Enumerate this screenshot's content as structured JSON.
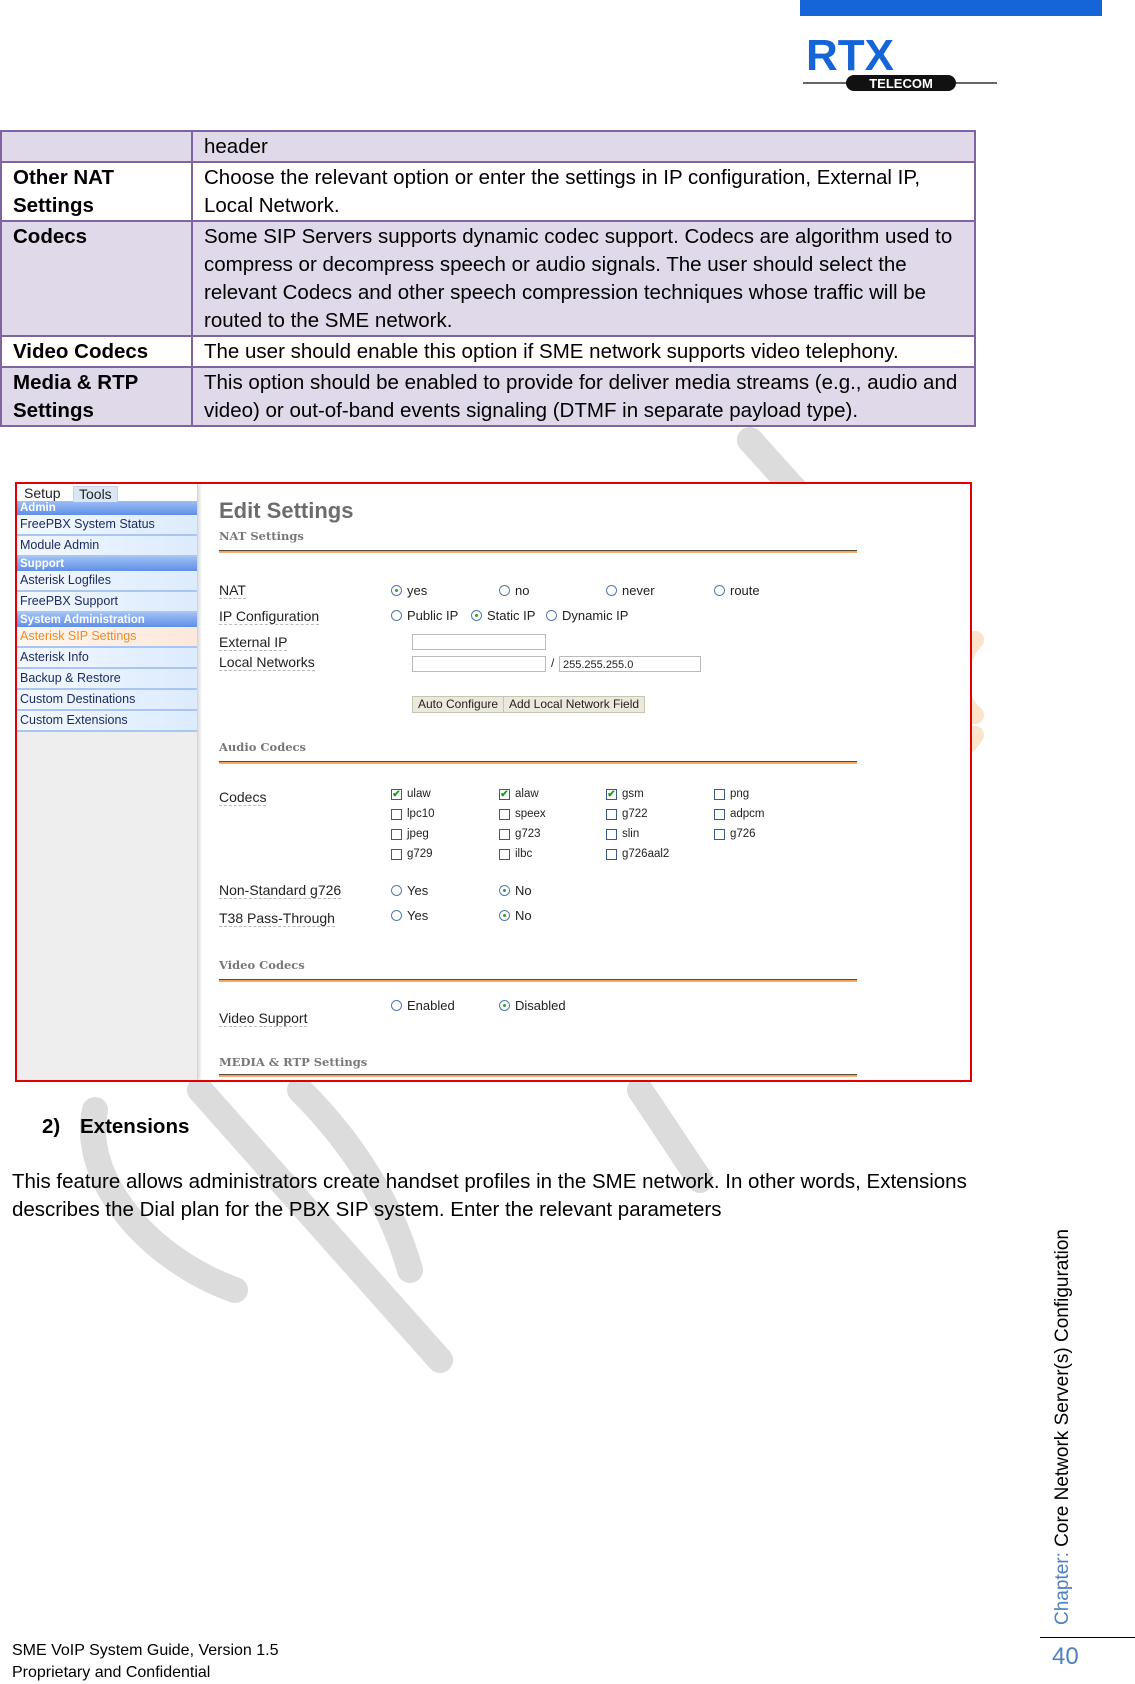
{
  "header": {
    "logo_main": "RTX",
    "logo_sub": "TELECOM",
    "colors": {
      "brand_blue": "#1565d8",
      "table_border": "#8064a2",
      "table_shade": "#e0d9ea",
      "frame_red": "#e30000"
    }
  },
  "table": {
    "rows": [
      {
        "key": "",
        "value": "header",
        "shaded": true
      },
      {
        "key": "Other NAT Settings",
        "value": "Choose the relevant option or enter the settings in IP configuration, External IP, Local Network.",
        "shaded": false
      },
      {
        "key": "Codecs",
        "value": "Some SIP Servers supports dynamic codec support. Codecs are algorithm used to compress or decompress speech or audio signals. The user should select the relevant Codecs and other speech compression techniques whose traffic will be routed to the SME network.",
        "shaded": true
      },
      {
        "key": "Video Codecs",
        "value": "The user should enable this option if SME network supports video telephony.",
        "shaded": false
      },
      {
        "key": "Media & RTP Settings",
        "value": "This option should be enabled to provide for deliver media streams (e.g., audio and video) or out-of-band events signaling (DTMF in separate payload type).",
        "shaded": true
      }
    ]
  },
  "screenshot": {
    "tabs": [
      "Setup",
      "Tools"
    ],
    "sidebar": [
      {
        "type": "section",
        "label": "Admin"
      },
      {
        "type": "item",
        "label": "FreePBX System Status"
      },
      {
        "type": "item",
        "label": "Module Admin"
      },
      {
        "type": "section",
        "label": "Support"
      },
      {
        "type": "item",
        "label": "Asterisk Logfiles"
      },
      {
        "type": "item",
        "label": "FreePBX Support"
      },
      {
        "type": "section",
        "label": "System Administration"
      },
      {
        "type": "item",
        "label": "Asterisk SIP Settings",
        "active": true
      },
      {
        "type": "item",
        "label": "Asterisk Info"
      },
      {
        "type": "item",
        "label": "Backup & Restore"
      },
      {
        "type": "item",
        "label": "Custom Destinations"
      },
      {
        "type": "item",
        "label": "Custom Extensions"
      }
    ],
    "title": "Edit Settings",
    "nat_section": "NAT Settings",
    "nat": {
      "label": "NAT",
      "options": [
        "yes",
        "no",
        "never",
        "route"
      ],
      "selected": "yes"
    },
    "ip_config": {
      "label": "IP Configuration",
      "options": [
        "Public IP",
        "Static IP",
        "Dynamic IP"
      ],
      "selected": "Static IP"
    },
    "external_ip": {
      "label": "External IP",
      "value": ""
    },
    "local_networks": {
      "label": "Local Networks",
      "value": "",
      "separator": "/",
      "mask": "255.255.255.0"
    },
    "buttons": {
      "auto_configure": "Auto Configure",
      "add_local_network": "Add Local Network Field"
    },
    "audio_section": "Audio Codecs",
    "codecs": {
      "label": "Codecs",
      "items": [
        {
          "name": "ulaw",
          "checked": true
        },
        {
          "name": "alaw",
          "checked": true
        },
        {
          "name": "gsm",
          "checked": true
        },
        {
          "name": "png",
          "checked": false
        },
        {
          "name": "lpc10",
          "checked": false
        },
        {
          "name": "speex",
          "checked": false
        },
        {
          "name": "g722",
          "checked": false
        },
        {
          "name": "adpcm",
          "checked": false
        },
        {
          "name": "jpeg",
          "checked": false
        },
        {
          "name": "g723",
          "checked": false
        },
        {
          "name": "slin",
          "checked": false
        },
        {
          "name": "g726",
          "checked": false
        },
        {
          "name": "g729",
          "checked": false
        },
        {
          "name": "ilbc",
          "checked": false
        },
        {
          "name": "g726aal2",
          "checked": false
        }
      ]
    },
    "non_standard_g726": {
      "label": "Non-Standard g726",
      "options": [
        "Yes",
        "No"
      ],
      "selected": "No"
    },
    "t38": {
      "label": "T38 Pass-Through",
      "options": [
        "Yes",
        "No"
      ],
      "selected": "No"
    },
    "video_section": "Video Codecs",
    "video_support": {
      "label": "Video Support",
      "options": [
        "Enabled",
        "Disabled"
      ],
      "selected": "Disabled"
    },
    "media_section": "MEDIA & RTP Settings"
  },
  "section": {
    "number": "2)",
    "title": "Extensions",
    "paragraph": "This feature allows administrators create handset profiles in the SME network. In other words, Extensions describes the Dial plan for the PBX SIP system. Enter the relevant parameters"
  },
  "sidebar_chapter": {
    "label": "Chapter:",
    "title": "Core Network Server(s) Configuration"
  },
  "page_number": "40",
  "footer": {
    "line1": "SME VoIP System Guide, Version 1.5",
    "line2": "Proprietary and Confidential"
  }
}
